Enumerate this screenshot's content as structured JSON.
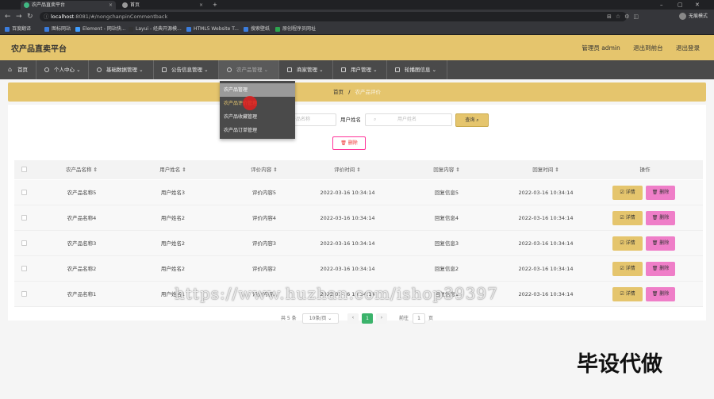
{
  "browser": {
    "tabs": [
      {
        "label": "农产品直卖平台",
        "icon_color": "#41b883"
      },
      {
        "label": "首页",
        "icon_color": "#888888"
      }
    ],
    "url_host": "localhost",
    "url_rest": ":8081/#/nongchanpinCommentback",
    "profile": "无痕模式",
    "bookmarks": [
      "百度翻译",
      "图标网站",
      "Element - 网站快...",
      "Layui - 经典开源模...",
      "HTML5 Website T...",
      "搜索壁纸",
      "原创程序员网址"
    ]
  },
  "header": {
    "title": "农产品直卖平台",
    "admin": "管理员 admin",
    "back_front": "退出到前台",
    "logout": "退出登录"
  },
  "nav": [
    "首页",
    "个人中心 ⌄",
    "基础数据管理 ⌄",
    "公告信息管理 ⌄",
    "农产品管理 ⌄",
    "商家管理 ⌄",
    "用户管理 ⌄",
    "轮播图信息 ⌄"
  ],
  "dropdown": [
    "农产品管理",
    "农产品评价管理",
    "农产品收藏管理",
    "农产品订单管理"
  ],
  "breadcrumb": {
    "home": "首页",
    "sep": "/",
    "current": "农产品评价"
  },
  "search": {
    "product_placeholder": "产品名称",
    "user_label": "用户姓名",
    "user_placeholder": "用户姓名",
    "query_btn": "查询 ⌕",
    "delete_btn": "🗑 删除"
  },
  "table": {
    "headers": [
      "农产品名称 ⇕",
      "用户姓名 ⇕",
      "评价内容 ⇕",
      "评价时间 ⇕",
      "回复内容 ⇕",
      "回复时间 ⇕",
      "操作"
    ],
    "rows": [
      [
        "农产品名称5",
        "用户姓名3",
        "评价内容5",
        "2022-03-16 10:34:14",
        "回复信息5",
        "2022-03-16 10:34:14"
      ],
      [
        "农产品名称4",
        "用户姓名2",
        "评价内容4",
        "2022-03-16 10:34:14",
        "回复信息4",
        "2022-03-16 10:34:14"
      ],
      [
        "农产品名称3",
        "用户姓名2",
        "评价内容3",
        "2022-03-16 10:34:14",
        "回复信息3",
        "2022-03-16 10:34:14"
      ],
      [
        "农产品名称2",
        "用户姓名2",
        "评价内容2",
        "2022-03-16 10:34:14",
        "回复信息2",
        "2022-03-16 10:34:14"
      ],
      [
        "农产品名称1",
        "用户姓名1",
        "评价内容1",
        "2022-03-16 10:34:14",
        "回复信息1",
        "2022-03-16 10:34:14"
      ]
    ],
    "detail_btn": "☑ 详情",
    "delete_btn": "🗑 删除"
  },
  "pagination": {
    "total": "共 5 条",
    "page_size": "10条/页 ⌄",
    "prev": "‹",
    "page": "1",
    "next": "›",
    "goto": "前往",
    "goto_value": "1",
    "page_unit": "页"
  },
  "watermark": "https://www.huzhan.com/ishop39397",
  "corner_text": "毕设代做"
}
